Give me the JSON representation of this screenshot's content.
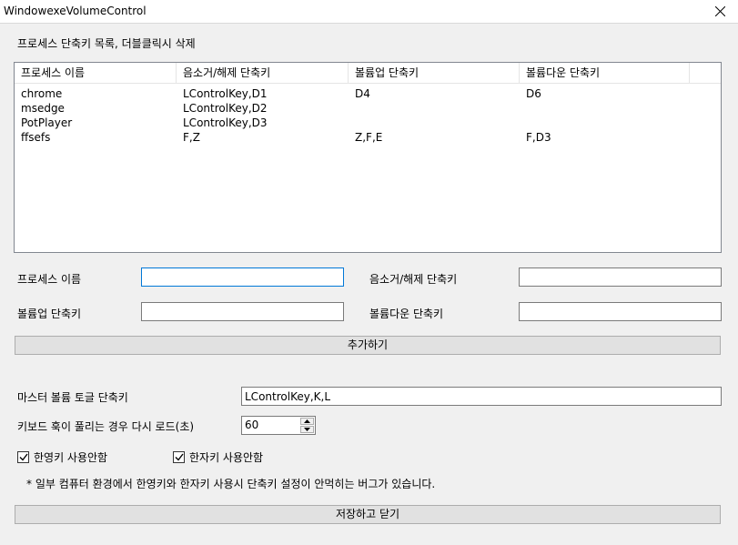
{
  "window": {
    "title": "WindowexeVolumeControl"
  },
  "list_label": "프로세스 단축키 목록, 더블클릭시 삭제",
  "list": {
    "columns": [
      "프로세스 이름",
      "음소거/해제 단축키",
      "볼륨업 단축키",
      "볼륨다운 단축키"
    ],
    "rows": [
      [
        "chrome",
        "LControlKey,D1",
        "D4",
        "D6"
      ],
      [
        "msedge",
        "LControlKey,D2",
        "",
        ""
      ],
      [
        "PotPlayer",
        "LControlKey,D3",
        "",
        ""
      ],
      [
        "ffsefs",
        "F,Z",
        "Z,F,E",
        "F,D3"
      ]
    ]
  },
  "form": {
    "process_name_label": "프로세스 이름",
    "process_name_value": "",
    "mute_label": "음소거/해제 단축키",
    "mute_value": "",
    "volup_label": "볼륨업 단축키",
    "volup_value": "",
    "voldown_label": "볼륨다운 단축키",
    "voldown_value": "",
    "add_button": "추가하기"
  },
  "settings": {
    "master_label": "마스터 볼륨 토글 단축키",
    "master_value": "LControlKey,K,L",
    "reload_label": "키보드 훅이 풀리는 경우 다시 로드(초)",
    "reload_value": "60",
    "hangul_label": "한영키 사용안함",
    "hanja_label": "한자키 사용안함",
    "hangul_checked": true,
    "hanja_checked": true,
    "note": "* 일부 컴퓨터 환경에서 한영키와 한자키 사용시 단축키 설정이 안먹히는 버그가 있습니다.",
    "save_button": "저장하고 닫기"
  }
}
